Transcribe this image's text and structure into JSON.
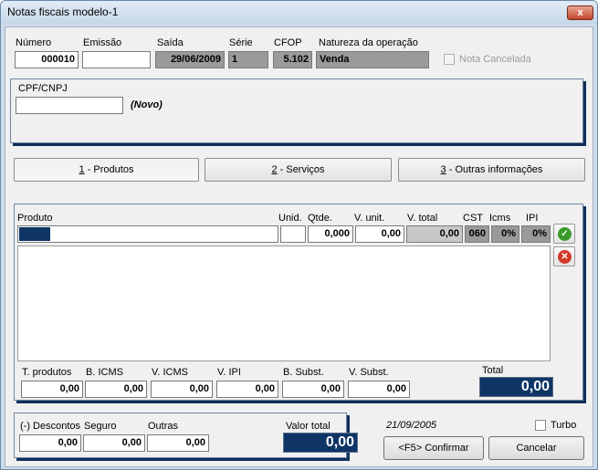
{
  "window": {
    "title": "Notas fiscais modelo-1",
    "close_glyph": "x"
  },
  "header": {
    "numero_label": "Número",
    "numero_value": "000010",
    "emissao_label": "Emissão",
    "emissao_value": "",
    "saida_label": "Saída",
    "saida_value": "29/06/2009",
    "serie_label": "Série",
    "serie_value": "1",
    "cfop_label": "CFOP",
    "cfop_value": "5.102",
    "natureza_label": "Natureza da operação",
    "natureza_value": "Venda",
    "nota_cancelada_label": "Nota Cancelada",
    "nota_cancelada_checked": false
  },
  "cliente": {
    "cpf_label": "CPF/CNPJ",
    "cpf_value": "",
    "status": "(Novo)"
  },
  "tabs": [
    {
      "key": "1",
      "label": " - Produtos",
      "active": true
    },
    {
      "key": "2",
      "label": " - Serviços",
      "active": false
    },
    {
      "key": "3",
      "label": " - Outras informações",
      "active": false
    }
  ],
  "items": {
    "columns": {
      "produto": "Produto",
      "unid": "Unid.",
      "qtde": "Qtde.",
      "v_unit": "V. unit.",
      "v_total": "V. total",
      "cst": "CST",
      "icms": "Icms",
      "ipi": "IPI"
    },
    "entry": {
      "produto": "",
      "unid": "",
      "qtde": "0,000",
      "v_unit": "0,00",
      "v_total": "0,00",
      "cst": "060",
      "icms": "0%",
      "ipi": "0%"
    },
    "rows": []
  },
  "totals": {
    "t_produtos_label": "T. produtos",
    "t_produtos": "0,00",
    "b_icms_label": "B. ICMS",
    "b_icms": "0,00",
    "v_icms_label": "V. ICMS",
    "v_icms": "0,00",
    "v_ipi_label": "V. IPI",
    "v_ipi": "0,00",
    "b_subst_label": "B. Subst.",
    "b_subst": "0,00",
    "v_subst_label": "V. Subst.",
    "v_subst": "0,00",
    "total_label": "Total",
    "total": "0,00"
  },
  "footer": {
    "descontos_label": "(-) Descontos",
    "descontos": "0,00",
    "seguro_label": "Seguro",
    "seguro": "0,00",
    "outras_label": "Outras",
    "outras": "0,00",
    "valor_total_label": "Valor total",
    "valor_total": "0,00",
    "date": "21/09/2005",
    "turbo_label": "Turbo",
    "turbo_checked": false,
    "confirm_label": "<F5> Confirmar",
    "cancel_label": "Cancelar"
  },
  "colors": {
    "accent": "#0e3566",
    "confirm_icon": "#3a9a2a",
    "delete_icon": "#d23a2a"
  }
}
